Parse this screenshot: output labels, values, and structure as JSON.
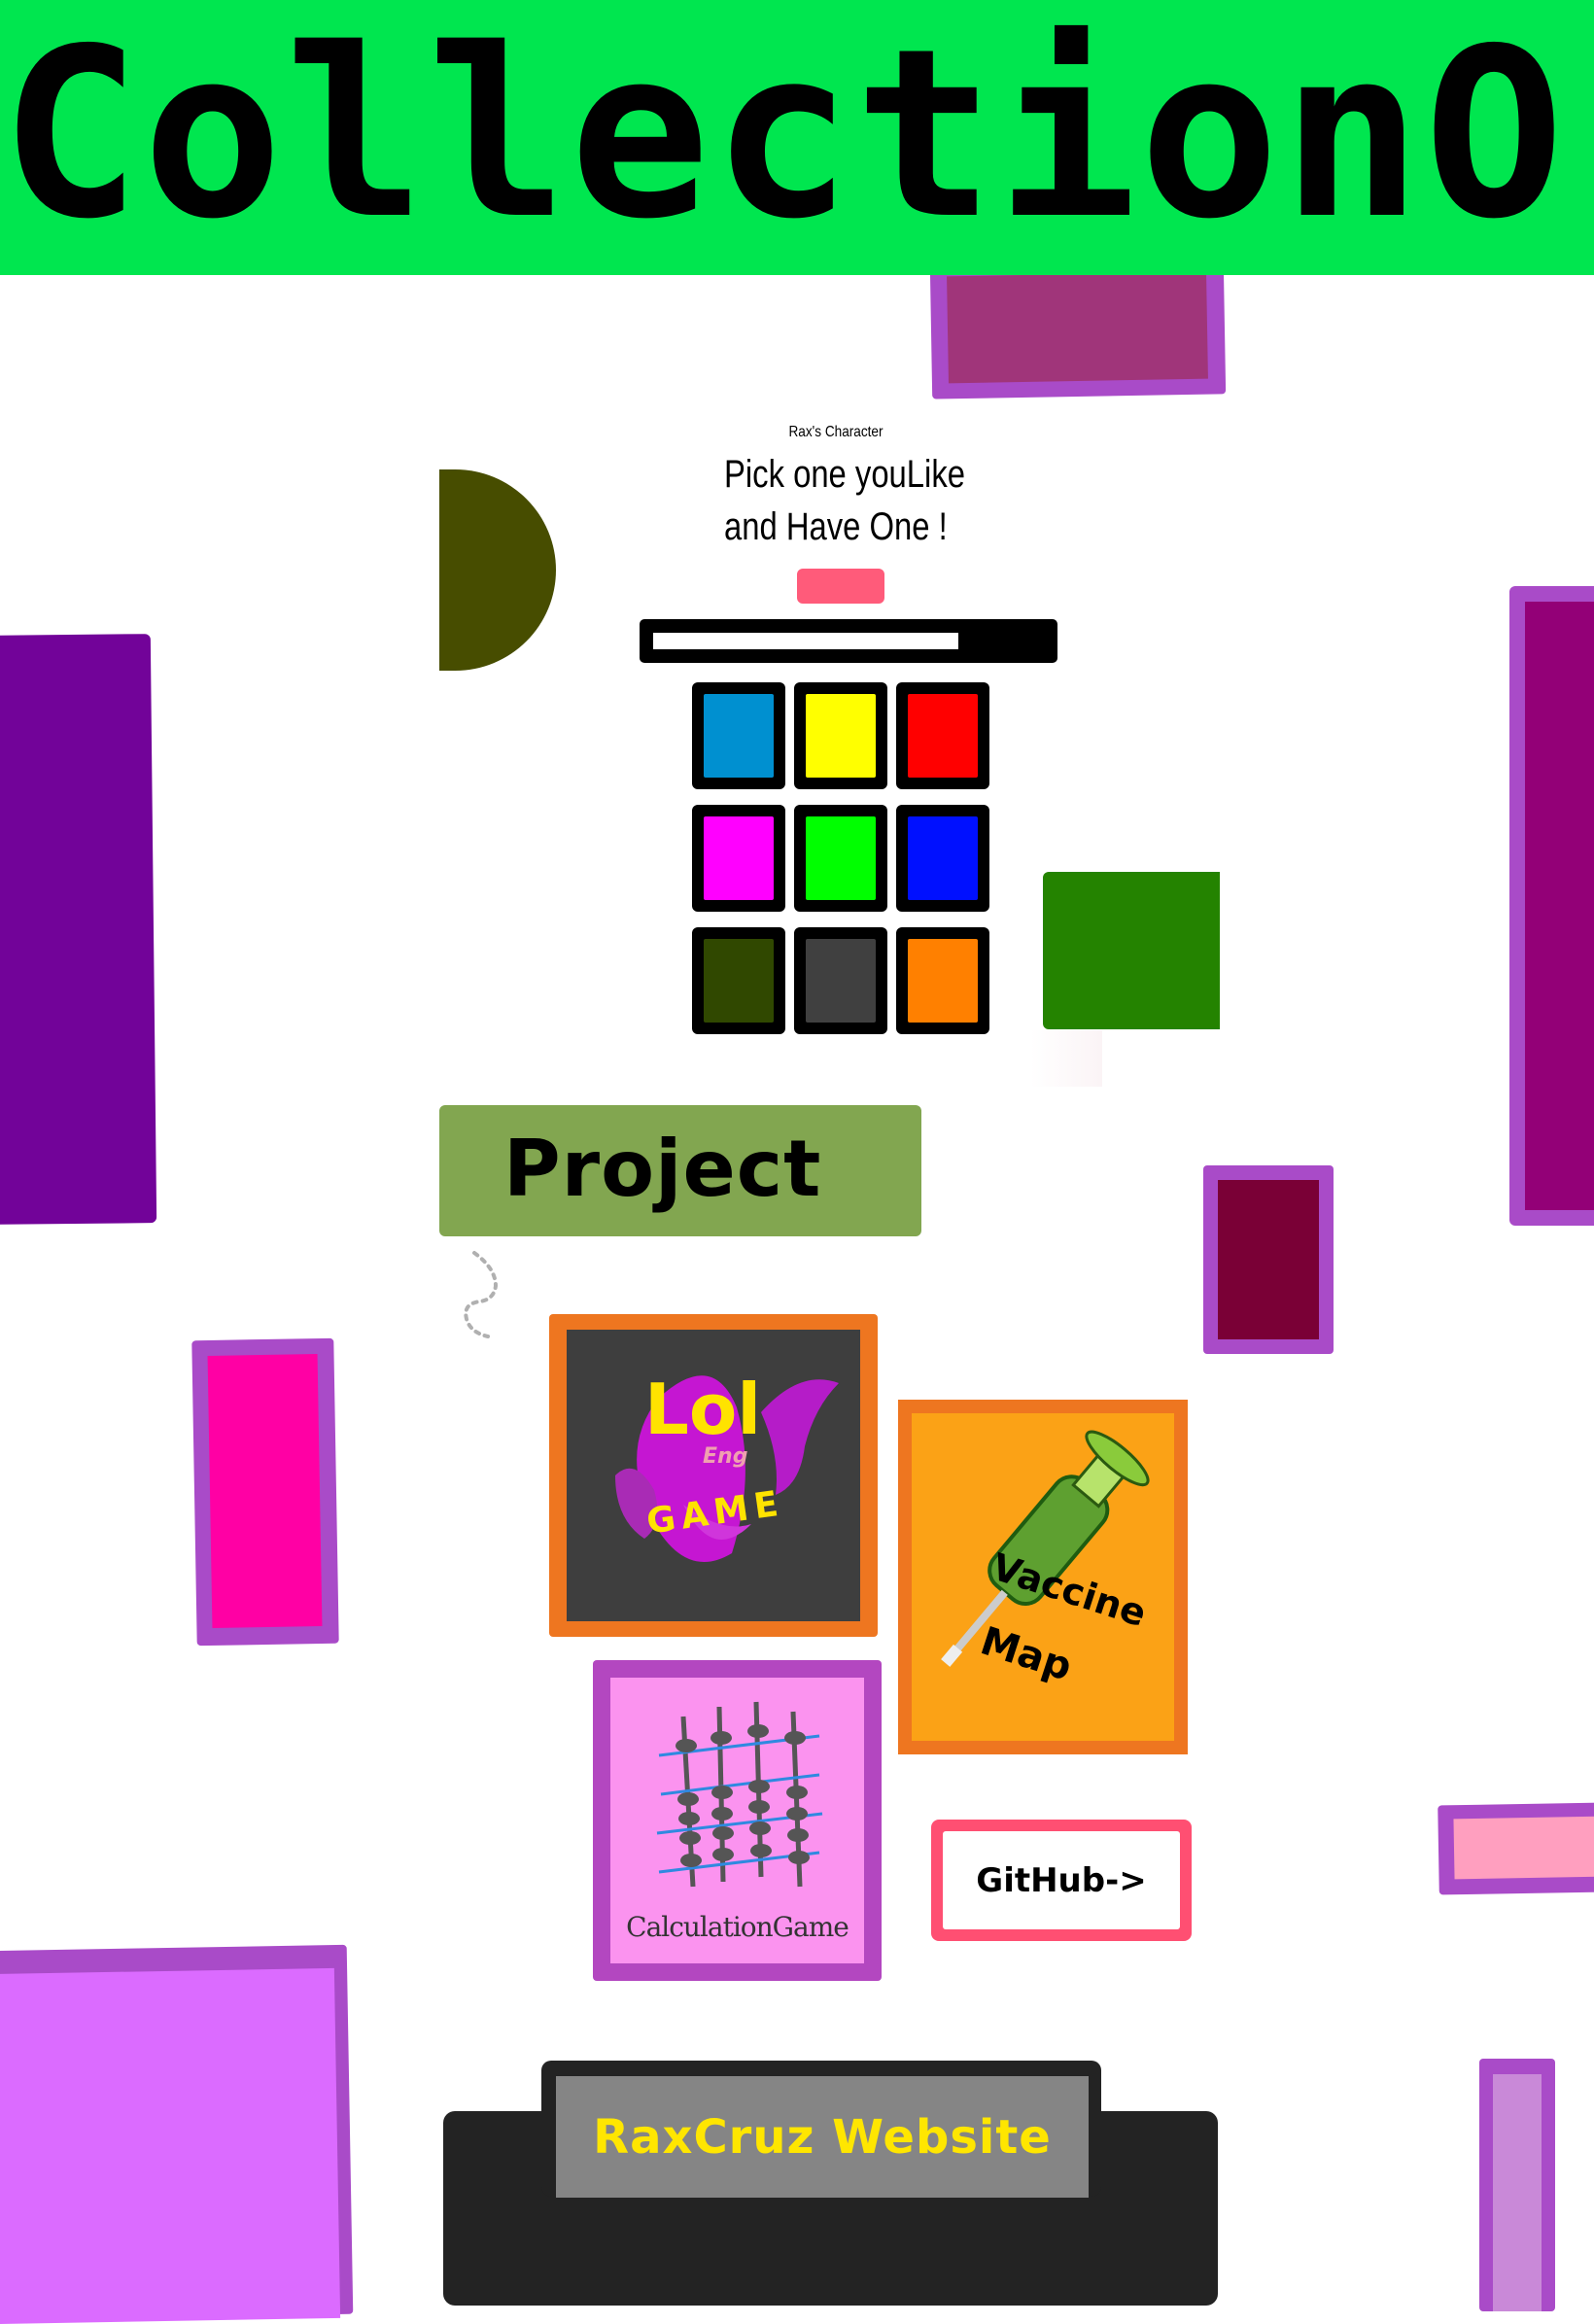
{
  "header": {
    "title": "CollectionO",
    "background": "#00e64f"
  },
  "character_picker": {
    "small_title": "Rax's Character",
    "headline_1": "Pick one youLike",
    "headline_2": "and Have One !",
    "action_button_color": "#ff5b7a",
    "progress_value": 0.78,
    "swatches": [
      {
        "name": "blue",
        "color": "#0090d0"
      },
      {
        "name": "yellow",
        "color": "#ffff00"
      },
      {
        "name": "red",
        "color": "#ff0000"
      },
      {
        "name": "magenta",
        "color": "#ff00ff"
      },
      {
        "name": "green",
        "color": "#00ff00"
      },
      {
        "name": "deep-blue",
        "color": "#0010ff"
      },
      {
        "name": "dark-olive",
        "color": "#304800"
      },
      {
        "name": "dark-gray",
        "color": "#404040"
      },
      {
        "name": "orange",
        "color": "#ff8000"
      }
    ]
  },
  "projects": {
    "title": "Project",
    "cards": [
      {
        "logo_text_1": "Lol",
        "logo_text_2": "Eng",
        "logo_text_3": "GAME"
      },
      {
        "logo_text_1": "Vaccine",
        "logo_text_2": "Map"
      },
      {
        "logo_text_1": "CalculationGame"
      }
    ],
    "github_label": "GitHub->"
  },
  "website": {
    "label": "RaxCruz Website"
  }
}
